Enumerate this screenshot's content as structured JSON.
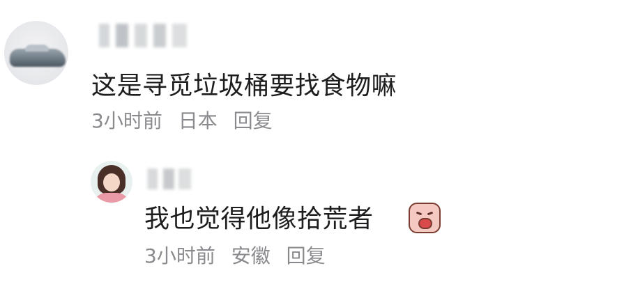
{
  "comment": {
    "text": "这是寻觅垃圾桶要找食物嘛",
    "time": "3小时前",
    "location": "日本",
    "reply_label": "回复"
  },
  "reply": {
    "text": "我也觉得他像拾荒者",
    "emoji_icon": "crying-face-icon",
    "time": "3小时前",
    "location": "安徽",
    "reply_label": "回复"
  }
}
